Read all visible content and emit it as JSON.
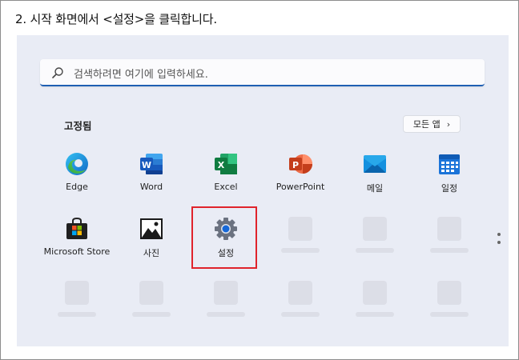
{
  "instruction": "2. 시작 화면에서 <설정>을 클릭합니다.",
  "search": {
    "placeholder": "검색하려면 여기에 입력하세요.",
    "icon": "search-icon"
  },
  "pinned": {
    "title": "고정됨",
    "all_apps_label": "모든 앱",
    "all_apps_icon": "chevron-right-icon",
    "apps": [
      {
        "name": "Edge",
        "icon": "edge-icon"
      },
      {
        "name": "Word",
        "icon": "word-icon"
      },
      {
        "name": "Excel",
        "icon": "excel-icon"
      },
      {
        "name": "PowerPoint",
        "icon": "powerpoint-icon"
      },
      {
        "name": "메일",
        "icon": "mail-icon"
      },
      {
        "name": "일정",
        "icon": "calendar-icon"
      },
      {
        "name": "Microsoft Store",
        "icon": "store-icon"
      },
      {
        "name": "사진",
        "icon": "photos-icon"
      },
      {
        "name": "설정",
        "icon": "settings-gear-icon"
      }
    ]
  },
  "highlight_color": "#e0232b",
  "accent_color": "#1f5fb3"
}
